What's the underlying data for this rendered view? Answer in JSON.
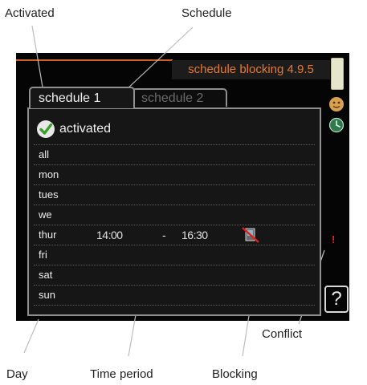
{
  "callouts": {
    "activated": "Activated",
    "schedule": "Schedule",
    "conflict": "Conflict",
    "day": "Day",
    "time_period": "Time period",
    "blocking": "Blocking"
  },
  "screen": {
    "title": "schedule blocking 4.9.5",
    "tabs": [
      {
        "label": "schedule 1",
        "active": true
      },
      {
        "label": "schedule 2",
        "active": false
      }
    ],
    "activated_label": "activated",
    "days": [
      {
        "day": "all",
        "start": "",
        "dash": "",
        "end": "",
        "blocking": false,
        "conflict": false
      },
      {
        "day": "mon",
        "start": "",
        "dash": "",
        "end": "",
        "blocking": false,
        "conflict": false
      },
      {
        "day": "tues",
        "start": "",
        "dash": "",
        "end": "",
        "blocking": false,
        "conflict": false
      },
      {
        "day": "we",
        "start": "",
        "dash": "",
        "end": "",
        "blocking": false,
        "conflict": false
      },
      {
        "day": "thur",
        "start": "14:00",
        "dash": "-",
        "end": "16:30",
        "blocking": true,
        "conflict": true
      },
      {
        "day": "fri",
        "start": "",
        "dash": "",
        "end": "",
        "blocking": false,
        "conflict": false
      },
      {
        "day": "sat",
        "start": "",
        "dash": "",
        "end": "",
        "blocking": false,
        "conflict": false
      },
      {
        "day": "sun",
        "start": "",
        "dash": "",
        "end": "",
        "blocking": false,
        "conflict": false
      }
    ],
    "conflict_mark": "!",
    "help_label": "?"
  },
  "colors": {
    "title_text": "#e8782f",
    "check_green": "#3a9e2a",
    "conflict_red": "#ff1a1a"
  },
  "icons": {
    "check": "check-icon",
    "blocking": "blocking-icon",
    "sidebar": [
      "scrollbar",
      "smiley-icon",
      "clock-icon"
    ],
    "help": "help-icon"
  }
}
